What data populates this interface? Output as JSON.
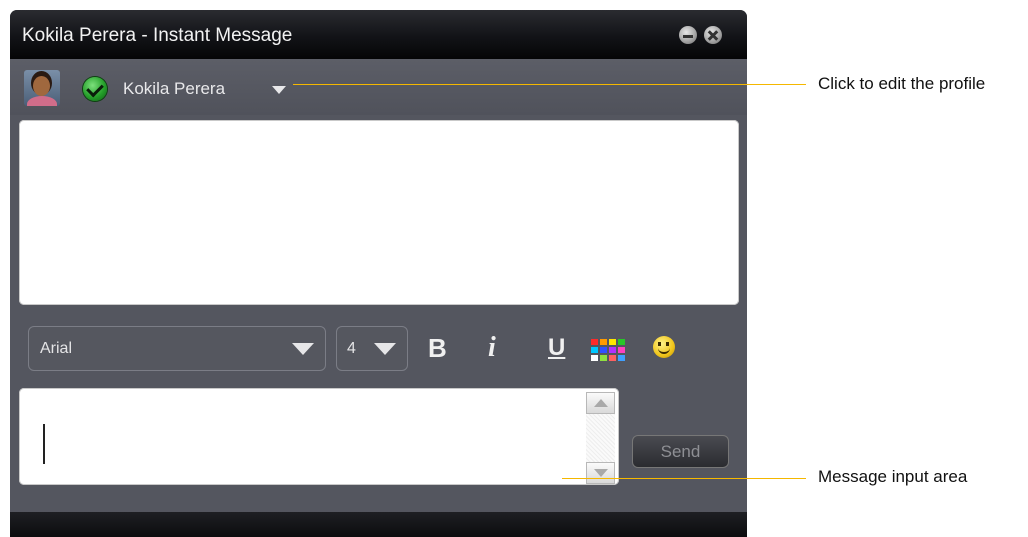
{
  "window": {
    "title": "Kokila Perera - Instant Message",
    "controls": [
      "minimize-icon",
      "close-icon"
    ]
  },
  "profile": {
    "name": "Kokila Perera",
    "status": "online",
    "status_icon": "check-circle-icon"
  },
  "toolbar": {
    "font": "Arial",
    "size": "4",
    "bold_label": "B",
    "italic_label": "i",
    "underline_label": "U",
    "color_palette": [
      "#ff2a2a",
      "#ff9a00",
      "#ffe600",
      "#28c628",
      "#00c8ff",
      "#3050ff",
      "#b030ff",
      "#ff40c0",
      "#ffffff",
      "#90e040",
      "#ff6060",
      "#40a0ff"
    ],
    "emoticon_icon": "smiley-icon"
  },
  "input": {
    "value": "",
    "send_label": "Send"
  },
  "colors": {
    "window_bg": "#54565f",
    "titlebar": "#121317",
    "callout_line": "#f5b800"
  },
  "annotations": {
    "profile": "Click to edit the profile",
    "input": "Message input area"
  }
}
